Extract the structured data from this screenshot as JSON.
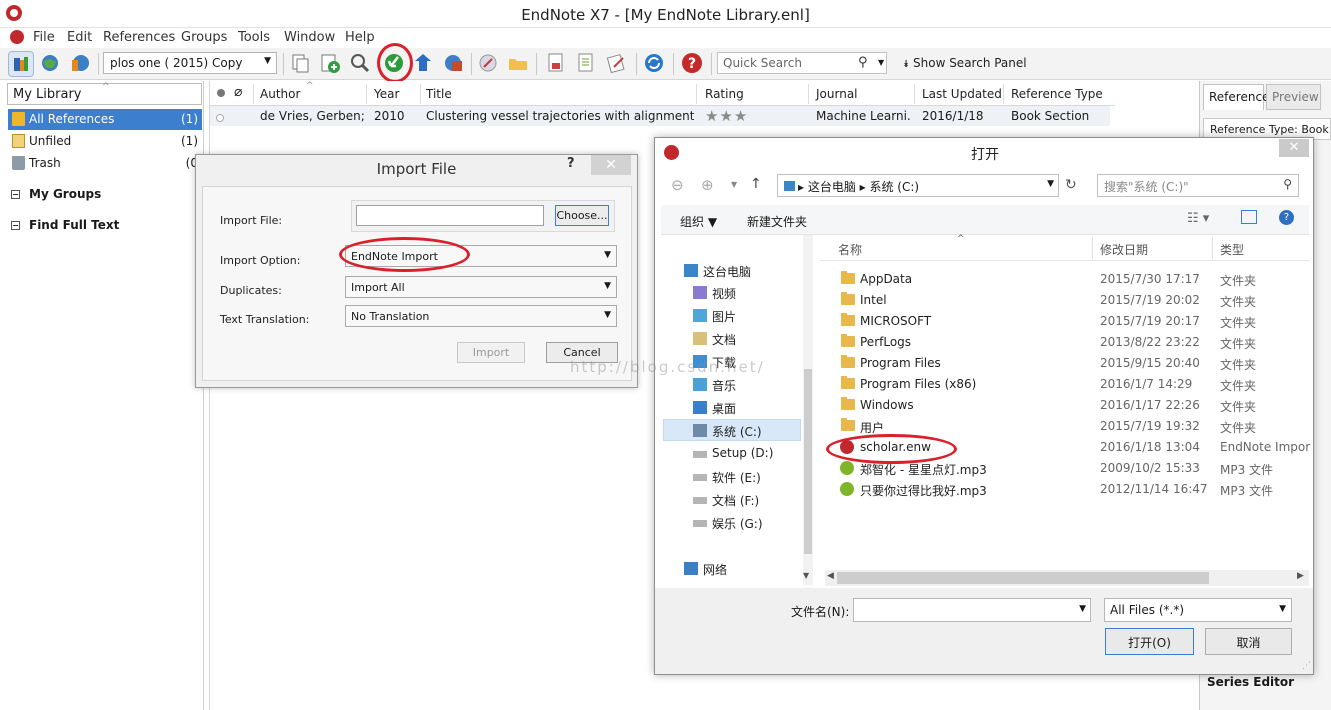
{
  "window": {
    "title": "EndNote X7 - [My EndNote Library.enl]"
  },
  "menu": [
    "File",
    "Edit",
    "References",
    "Groups",
    "Tools",
    "Window",
    "Help"
  ],
  "toolbar": {
    "style_value": "plos one ( 2015) Copy",
    "search_placeholder": "Quick Search",
    "show_search_panel": "Show Search Panel"
  },
  "library": {
    "header": "My Library",
    "items": [
      {
        "label": "All References",
        "count": "(1)"
      },
      {
        "label": "Unfiled",
        "count": "(1)"
      },
      {
        "label": "Trash",
        "count": "(0"
      }
    ],
    "groups": [
      "My Groups",
      "Find Full Text"
    ]
  },
  "ref_list": {
    "columns": [
      "Author",
      "Year",
      "Title",
      "Rating",
      "Journal",
      "Last Updated",
      "Reference Type"
    ],
    "rows": [
      {
        "author": "de Vries, Gerben; ...",
        "year": "2010",
        "title": "Clustering vessel trajectories with alignment kern...",
        "rating_stars": 3,
        "journal": "Machine Learni...",
        "last_updated": "2016/1/18",
        "ref_type": "Book Section"
      }
    ]
  },
  "right_pane": {
    "tab_reference": "Reference",
    "tab_preview": "Preview",
    "reference_type": "Reference Type:  Book S",
    "series_editor": "Series Editor"
  },
  "import_dialog": {
    "title": "Import File",
    "help": "?",
    "labels": {
      "import_file": "Import File:",
      "import_option": "Import Option:",
      "duplicates": "Duplicates:",
      "text_translation": "Text Translation:"
    },
    "values": {
      "import_option": "EndNote Import",
      "duplicates": "Import All",
      "text_translation": "No Translation"
    },
    "buttons": {
      "choose": "Choose...",
      "import": "Import",
      "cancel": "Cancel"
    }
  },
  "open_dialog": {
    "title": "打开",
    "breadcrumb": "▸  这台电脑  ▸  系统 (C:)",
    "search_placeholder": "搜索\"系统 (C:)\"",
    "organize": "组织 ▼",
    "new_folder": "新建文件夹",
    "columns": {
      "name": "名称",
      "date": "修改日期",
      "type": "类型"
    },
    "nav": [
      "这台电脑",
      "视频",
      "图片",
      "文档",
      "下载",
      "音乐",
      "桌面",
      "系统 (C:)",
      "Setup (D:)",
      "软件 (E:)",
      "文档 (F:)",
      "娱乐 (G:)",
      "网络"
    ],
    "files": [
      {
        "name": "AppData",
        "date": "2015/7/30 17:17",
        "type": "文件夹",
        "kind": "folder"
      },
      {
        "name": "Intel",
        "date": "2015/7/19 20:02",
        "type": "文件夹",
        "kind": "folder"
      },
      {
        "name": "MICROSOFT",
        "date": "2015/7/19 20:17",
        "type": "文件夹",
        "kind": "folder"
      },
      {
        "name": "PerfLogs",
        "date": "2013/8/22 23:22",
        "type": "文件夹",
        "kind": "folder"
      },
      {
        "name": "Program Files",
        "date": "2015/9/15 20:40",
        "type": "文件夹",
        "kind": "folder"
      },
      {
        "name": "Program Files (x86)",
        "date": "2016/1/7 14:29",
        "type": "文件夹",
        "kind": "folder"
      },
      {
        "name": "Windows",
        "date": "2016/1/17 22:26",
        "type": "文件夹",
        "kind": "folder"
      },
      {
        "name": "用户",
        "date": "2015/7/19 19:32",
        "type": "文件夹",
        "kind": "folder"
      },
      {
        "name": "scholar.enw",
        "date": "2016/1/18 13:04",
        "type": "EndNote Impor",
        "kind": "endnote"
      },
      {
        "name": "郑智化 - 星星点灯.mp3",
        "date": "2009/10/2 15:33",
        "type": "MP3 文件",
        "kind": "mp3"
      },
      {
        "name": "只要你过得比我好.mp3",
        "date": "2012/11/14 16:47",
        "type": "MP3 文件",
        "kind": "mp3"
      }
    ],
    "filename_label": "文件名(N):",
    "filetype_value": "All Files (*.*)",
    "open_button": "打开(O)",
    "cancel_button": "取消"
  },
  "watermark": "http://blog.csdn.net/",
  "colors": {
    "selection": "#3c7fcf",
    "annotation": "#d9212b",
    "endnote_red": "#c0282d"
  }
}
